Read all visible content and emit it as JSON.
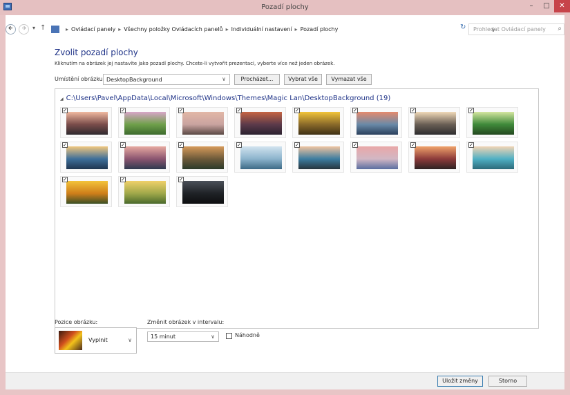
{
  "window": {
    "title": "Pozadí plochy",
    "minimize": "–",
    "maximize": "□",
    "close": "✕"
  },
  "address": {
    "back_icon": "arrow-left-icon",
    "forward_icon": "arrow-right-icon",
    "recent": "▾",
    "up": "↑",
    "breadcrumbs": [
      "Ovládací panely",
      "Všechny položky Ovládacích panelů",
      "Individuální nastavení",
      "Pozadí plochy"
    ],
    "separator": "▸",
    "dropdown": "∨",
    "refresh": "↻",
    "search_placeholder": "Prohledat Ovládací panely",
    "search_icon": "⌕"
  },
  "main": {
    "heading": "Zvolit pozadí plochy",
    "description": "Kliknutím na obrázek jej nastavíte jako pozadí plochy. Chcete-li vytvořit prezentaci, vyberte více než jeden obrázek.",
    "location_label": "Umístění obrázku:",
    "location_value": "DesktopBackground",
    "browse_label": "Procházet...",
    "select_all_label": "Vybrat vše",
    "clear_all_label": "Vymazat vše",
    "folder_toggle": "◢",
    "folder_path": "C:\\Users\\Pavel\\AppData\\Local\\Microsoft\\Windows\\Themes\\Magic Lan\\DesktopBackground (19)",
    "checkmark": "✓",
    "thumbnails": [
      {
        "c1": "#f0b9a0",
        "c2": "#7a4c4a",
        "c3": "#2f2a2f"
      },
      {
        "c1": "#d8a6c8",
        "c2": "#6fa04a",
        "c3": "#3d6a2e"
      },
      {
        "c1": "#e2b7a6",
        "c2": "#c9a3a0",
        "c3": "#5a4944"
      },
      {
        "c1": "#c66544",
        "c2": "#5c3a4a",
        "c3": "#2b2230"
      },
      {
        "c1": "#f2c53a",
        "c2": "#8a6a2a",
        "c3": "#3f3015"
      },
      {
        "c1": "#e58a6d",
        "c2": "#6a8aa8",
        "c3": "#2a3f5c"
      },
      {
        "c1": "#f0d9b8",
        "c2": "#6a5f55",
        "c3": "#2d2c2e"
      },
      {
        "c1": "#d4e6a0",
        "c2": "#3f8a3a",
        "c3": "#24481f"
      },
      {
        "c1": "#f1c77e",
        "c2": "#3e6f9a",
        "c3": "#1f3550"
      },
      {
        "c1": "#e7a9a0",
        "c2": "#8b5570",
        "c3": "#2e3a4f"
      },
      {
        "c1": "#d69a5a",
        "c2": "#6d5a3a",
        "c3": "#2b3a2a"
      },
      {
        "c1": "#d1e3ef",
        "c2": "#8cb3cc",
        "c3": "#3d6a86"
      },
      {
        "c1": "#f0c4a0",
        "c2": "#3d7da0",
        "c3": "#27353d"
      },
      {
        "c1": "#e9a7a7",
        "c2": "#d2b7c4",
        "c3": "#5a6ea0"
      },
      {
        "c1": "#f0a26a",
        "c2": "#8c3a3a",
        "c3": "#2c2222"
      },
      {
        "c1": "#f2d4b4",
        "c2": "#4fb0c4",
        "c3": "#2c6a7a"
      },
      {
        "c1": "#f3c33a",
        "c2": "#cf7e1a",
        "c3": "#3a4f25"
      },
      {
        "c1": "#f0d06a",
        "c2": "#a0a84a",
        "c3": "#4a6a2c"
      },
      {
        "c1": "#4a4f58",
        "c2": "#1f2226",
        "c3": "#0d0e10"
      }
    ]
  },
  "options": {
    "position_label": "Pozice obrázku:",
    "position_value": "Vyplnit",
    "interval_label": "Změnit obrázek v intervalu:",
    "interval_value": "15 minut",
    "shuffle_label": "Náhodně",
    "chevron": "∨"
  },
  "footer": {
    "save_label": "Uložit změny",
    "cancel_label": "Storno"
  }
}
